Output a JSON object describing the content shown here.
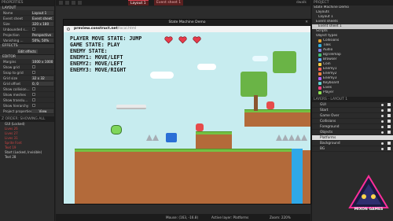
{
  "left_panel": {
    "title": "PROPERTIES",
    "layout_section": "LAYOUT",
    "props": [
      {
        "k": "Name",
        "v": "Layout 1"
      },
      {
        "k": "Event sheet",
        "v": "Event sheet 1"
      },
      {
        "k": "Size",
        "v": "320 x 180"
      },
      {
        "k": "Unbounded s...",
        "v": ""
      },
      {
        "k": "Projection",
        "v": "Perspective"
      },
      {
        "k": "Vanishing ...",
        "v": "50%, 50%"
      }
    ],
    "effects_section": "EFFECTS",
    "edit_effects": "Edit effects",
    "editor_section": "EDITOR",
    "editor_props": [
      {
        "k": "Margins",
        "v": "1000 x 1000"
      },
      {
        "k": "Show grid",
        "v": ""
      },
      {
        "k": "Snap to grid",
        "v": ""
      },
      {
        "k": "Grid size",
        "v": "32 x 32"
      },
      {
        "k": "Grid offset",
        "v": "0, 0"
      },
      {
        "k": "Show collision...",
        "v": ""
      },
      {
        "k": "Show meshes",
        "v": ""
      },
      {
        "k": "Show translu...",
        "v": ""
      },
      {
        "k": "Show hierarchy",
        "v": ""
      }
    ],
    "project_props": "Project properties",
    "view_btn": "View",
    "z_order_title": "Z ORDER: SHOWING ALL",
    "z_items": [
      {
        "label": "GUI (Locked)",
        "cls": "w"
      },
      {
        "label": "Lives 26",
        "cls": ""
      },
      {
        "label": "Lives 27",
        "cls": ""
      },
      {
        "label": "Lives 31",
        "cls": ""
      },
      {
        "label": "Sprite Font",
        "cls": ""
      },
      {
        "label": "Text 19",
        "cls": ""
      }
    ],
    "z_footer": "Start (Locked, Invisible)",
    "z_footer2": "Text 28"
  },
  "topbar": {
    "tab_active": "Layout 1",
    "tab_other": "Event sheet 1",
    "right_label": "dwalk"
  },
  "game_window": {
    "title": "State Machine Demo",
    "url_domain": "preview.construct.net",
    "url_path": "/local.html",
    "hud_lines": [
      "PLAYER MOVE STATE: JUMP",
      "GAME STATE: PLAY",
      "ENEMY STATE:",
      "ENEMY1: MOVE/LEFT",
      "ENEMY2: MOVE/LEFT",
      "ENEMY3: MOVE/RIGHT"
    ],
    "hearts": 3
  },
  "status": {
    "mouse": "Mouse: (163, -16.8)",
    "active_layer": "Active layer: Platforms",
    "zoom": "Zoom: 220%"
  },
  "right_panel": {
    "title": "PROJECT",
    "tree": [
      {
        "label": "State Machine Demo",
        "ind": 2,
        "cls": ""
      },
      {
        "label": "Layouts",
        "ind": 5,
        "cls": ""
      },
      {
        "label": "Layout 1",
        "ind": 8,
        "cls": ""
      },
      {
        "label": "Event sheets",
        "ind": 5,
        "cls": ""
      },
      {
        "label": "Event sheet 1",
        "ind": 8,
        "cls": "sel"
      },
      {
        "label": "Scripts",
        "ind": 5,
        "cls": ""
      },
      {
        "label": "Object types",
        "ind": 5,
        "cls": ""
      },
      {
        "label": "Collisions",
        "ind": 8,
        "cls": "c1"
      },
      {
        "label": "Tiles",
        "ind": 8,
        "cls": "c2"
      },
      {
        "label": "Audio",
        "ind": 8,
        "cls": "c3"
      },
      {
        "label": "BgTilemap",
        "ind": 8,
        "cls": "c4"
      },
      {
        "label": "Browser",
        "ind": 8,
        "cls": "c5"
      },
      {
        "label": "Coin",
        "ind": 8,
        "cls": "c6"
      },
      {
        "label": "Enemy1",
        "ind": 8,
        "cls": "c7"
      },
      {
        "label": "Enemy2",
        "ind": 8,
        "cls": "c8"
      },
      {
        "label": "Enemy3",
        "ind": 8,
        "cls": "c9"
      },
      {
        "label": "Keyboard",
        "ind": 8,
        "cls": "c10"
      },
      {
        "label": "Lives",
        "ind": 8,
        "cls": "c11"
      },
      {
        "label": "Player",
        "ind": 8,
        "cls": "c12"
      }
    ],
    "layers_title": "LAYERS - LAYOUT 1",
    "layers": [
      {
        "label": "GUI",
        "cls": ""
      },
      {
        "label": "Start",
        "cls": ""
      },
      {
        "label": "Game Over",
        "cls": ""
      },
      {
        "label": "Collisions",
        "cls": ""
      },
      {
        "label": "Foreground",
        "cls": ""
      },
      {
        "label": "Objects",
        "cls": ""
      },
      {
        "label": "Platforms",
        "cls": "sel"
      },
      {
        "label": "Background",
        "cls": ""
      },
      {
        "label": "BG",
        "cls": ""
      }
    ],
    "logo_text": "MIXON GAMES"
  }
}
